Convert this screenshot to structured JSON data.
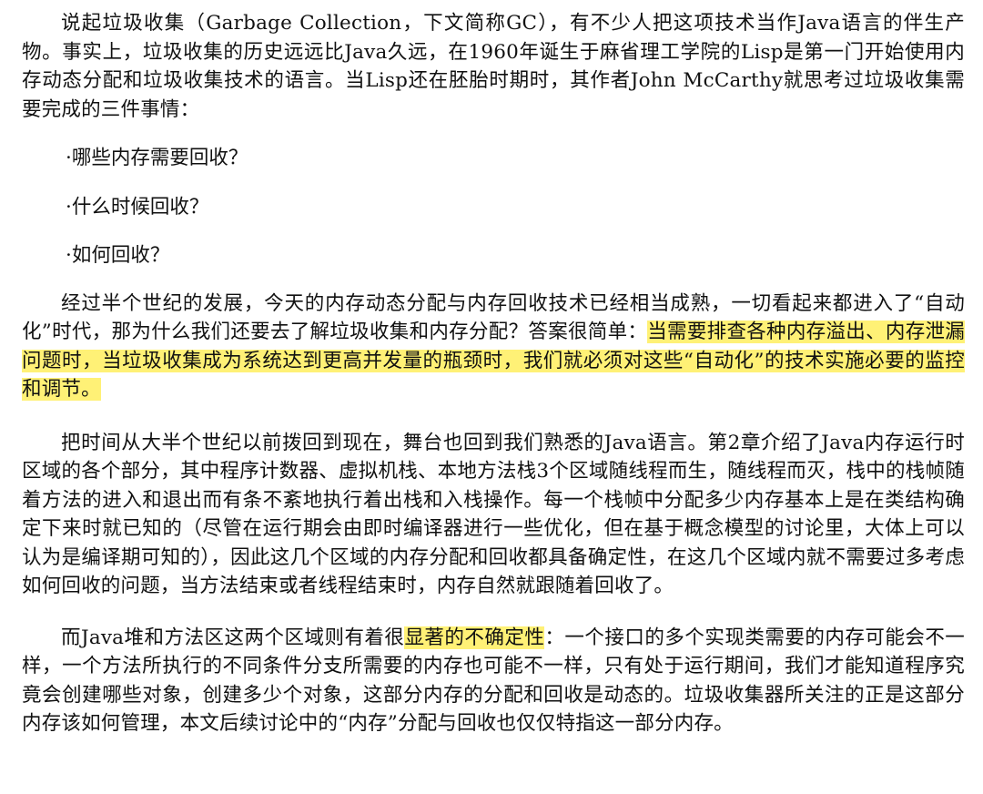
{
  "intro": {
    "text": "说起垃圾收集（Garbage Collection，下文简称GC），有不少人把这项技术当作Java语言的伴生产物。事实上，垃圾收集的历史远远比Java久远，在1960年诞生于麻省理工学院的Lisp是第一门开始使用内存动态分配和垃圾收集技术的语言。当Lisp还在胚胎时期时，其作者John McCarthy就思考过垃圾收集需要完成的三件事情："
  },
  "questions": [
    "·哪些内存需要回收？",
    "·什么时候回收？",
    "·如何回收？"
  ],
  "development": {
    "before": "经过半个世纪的发展，今天的内存动态分配与内存回收技术已经相当成熟，一切看起来都进入了“自动化”时代，那为什么我们还要去了解垃圾收集和内存分配？答案很简单：",
    "highlight": "当需要排查各种内存溢出、内存泄漏问题时，当垃圾收集成为系统达到更高并发量的瓶颈时，我们就必须对这些“自动化”的技术实施必要的监控和调节。"
  },
  "runtime_areas": {
    "text": "把时间从大半个世纪以前拨回到现在，舞台也回到我们熟悉的Java语言。第2章介绍了Java内存运行时区域的各个部分，其中程序计数器、虚拟机栈、本地方法栈3个区域随线程而生，随线程而灭，栈中的栈帧随着方法的进入和退出而有条不紊地执行着出栈和入栈操作。每一个栈帧中分配多少内存基本上是在类结构确定下来时就已知的（尽管在运行期会由即时编译器进行一些优化，但在基于概念模型的讨论里，大体上可以认为是编译期可知的），因此这几个区域的内存分配和回收都具备确定性，在这几个区域内就不需要过多考虑如何回收的问题，当方法结束或者线程结束时，内存自然就跟随着回收了。"
  },
  "heap": {
    "before": "而Java堆和方法区这两个区域则有着很",
    "highlight": "显著的不确定性",
    "after": "：一个接口的多个实现类需要的内存可能会不一样，一个方法所执行的不同条件分支所需要的内存也可能不一样，只有处于运行期间，我们才能知道程序究竟会创建哪些对象，创建多少个对象，这部分内存的分配和回收是动态的。垃圾收集器所关注的正是这部分内存该如何管理，本文后续讨论中的“内存”分配与回收也仅仅特指这一部分内存。"
  },
  "colors": {
    "highlight": "#fff176",
    "text": "#111111"
  }
}
